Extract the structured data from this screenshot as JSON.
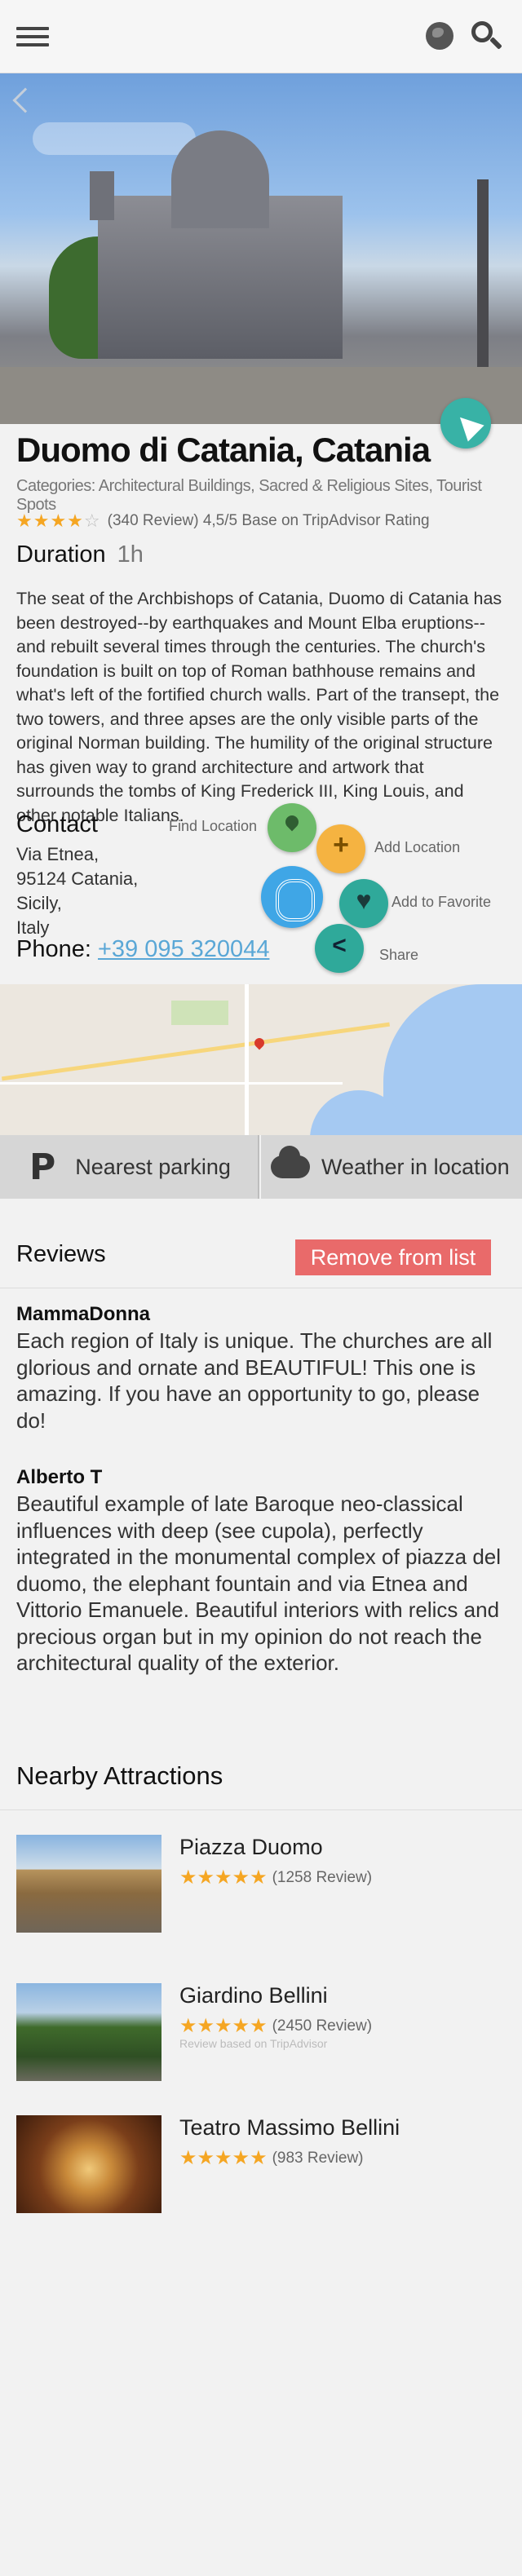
{
  "detail": {
    "title": "Duomo di Catania, Catania",
    "categories": "Categories: Architectural Buildings, Sacred & Religious Sites, Tourist Spots",
    "rating_stars": "★★★★",
    "rating_empty": "☆",
    "rating_text": "(340 Review) 4,5/5 Base on TripAdvisor Rating",
    "rating_value": 4.5,
    "duration_label": "Duration",
    "duration_value": "1h",
    "description": "The seat of the Archbishops of Catania, Duomo di Catania has been destroyed--by earthquakes and Mount Elba eruptions--and rebuilt several times through the centuries. The church's foundation is built on top of Roman bathhouse remains and what's left of the fortified church walls. Part of the transept, the two towers, and three apses are the only visible parts of the original Norman building. The humility of the original structure has given way to grand architecture and artwork that surrounds the tombs of King Frederick III, King Louis, and other notable Italians."
  },
  "contact": {
    "title": "Contact",
    "address_lines": [
      "Via Etnea,",
      "95124 Catania,",
      "Sicily,",
      "Italy"
    ],
    "phone_label": "Phone:",
    "phone_number": "+39 095 320044"
  },
  "actions": {
    "find_location": "Find Location",
    "add_location": "Add Location",
    "add_favorite": "Add to Favorite",
    "share": "Share"
  },
  "services": {
    "parking": "Nearest parking",
    "weather": "Weather in location"
  },
  "reviews": {
    "title": "Reviews",
    "remove_button": "Remove from list",
    "items": [
      {
        "author": "MammaDonna",
        "text": "Each region of Italy is unique. The churches are all glorious and ornate and BEAUTIFUL! This one is amazing. If you have an opportunity to go, please do!"
      },
      {
        "author": "Alberto T",
        "text": "Beautiful example of late Baroque neo-classical influences with deep (see cupola), perfectly integrated in the monumental complex of piazza del duomo, the elephant fountain and via Etnea and Vittorio Emanuele. Beautiful interiors with relics and precious organ but in my opinion do not reach the architectural quality of the exterior."
      }
    ]
  },
  "nearby": {
    "title": "Nearby Attractions",
    "items": [
      {
        "name": "Piazza Duomo",
        "stars": "★★★★★",
        "reviews": "(1258 Review)",
        "note": ""
      },
      {
        "name": "Giardino Bellini",
        "stars": "★★★★★",
        "reviews": "(2450 Review)",
        "note": "Review based on TripAdvisor"
      },
      {
        "name": "Teatro Massimo Bellini",
        "stars": "★★★★★",
        "reviews": "(983 Review)",
        "note": ""
      }
    ]
  },
  "colors": {
    "accent_teal": "#38b2a6",
    "remove_red": "#e96a6a",
    "phone_link": "#5aa7d6",
    "star": "#f5a623"
  }
}
